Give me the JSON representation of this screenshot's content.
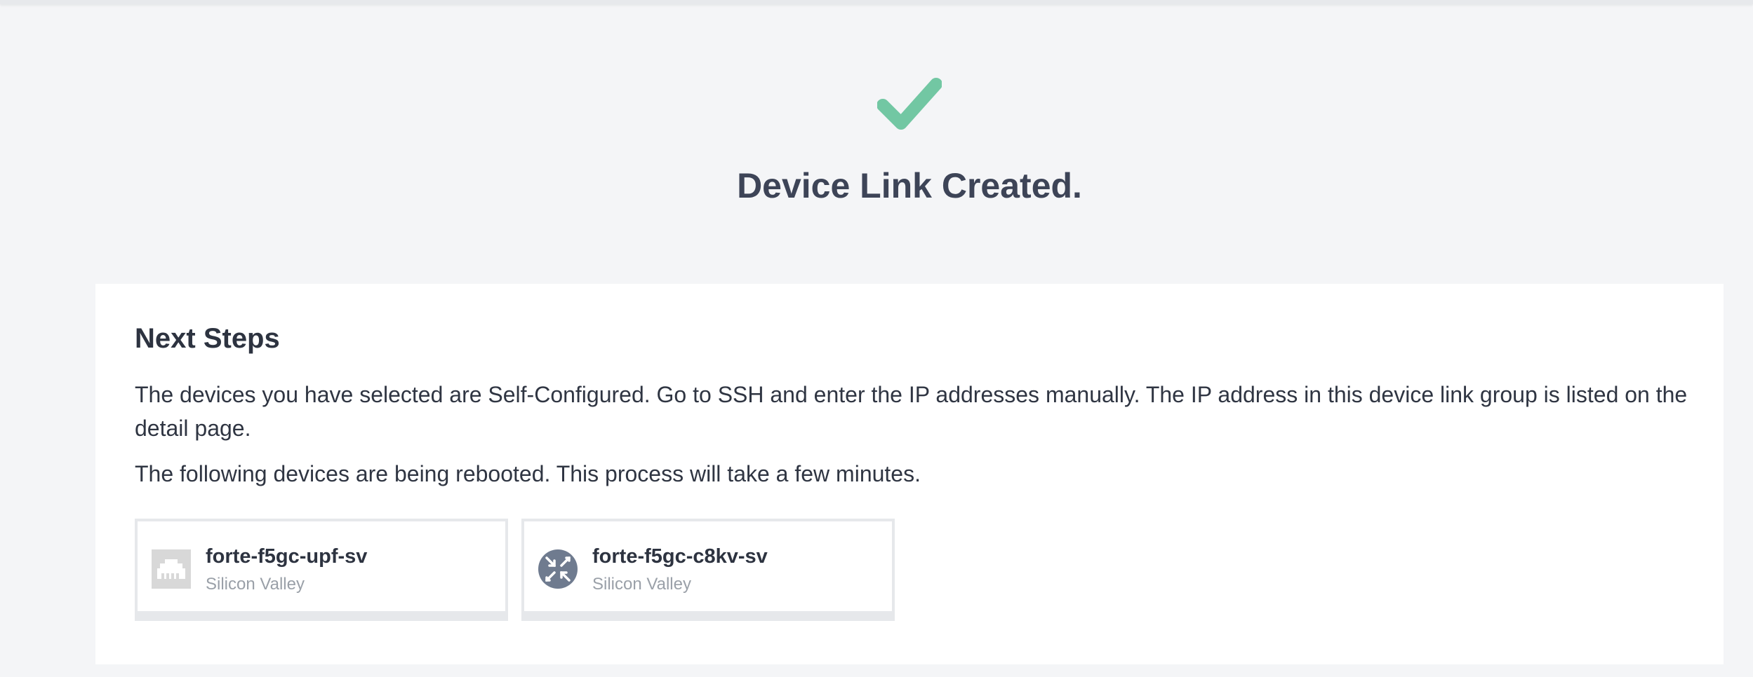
{
  "header": {
    "icon": "checkmark-icon",
    "title": "Device Link Created."
  },
  "next_steps": {
    "heading": "Next Steps",
    "paragraph_1": "The devices you have selected are Self-Configured. Go to SSH and enter the IP addresses manually. The IP address in this device link group is listed on the detail page.",
    "paragraph_2": "The following devices are being rebooted. This process will take a few minutes."
  },
  "devices": [
    {
      "name": "forte-f5gc-upf-sv",
      "location": "Silicon Valley",
      "icon": "ethernet-port-icon"
    },
    {
      "name": "forte-f5gc-c8kv-sv",
      "location": "Silicon Valley",
      "icon": "router-icon"
    }
  ],
  "colors": {
    "success": "#72c7a3",
    "title": "#3d4457",
    "background": "#f4f5f7",
    "router_icon": "#6f7b8f",
    "port_icon": "#d8d8d8"
  }
}
